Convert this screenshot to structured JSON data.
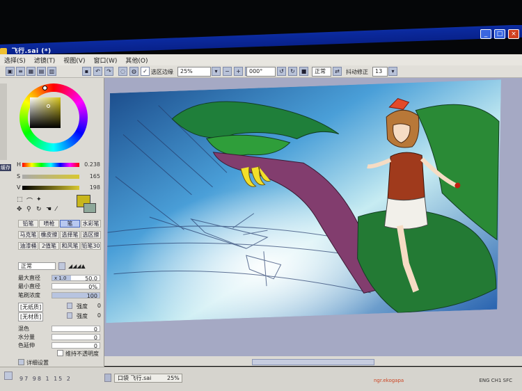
{
  "window": {
    "title": "飞行.sai (*)",
    "buttons": [
      "_",
      "□",
      "×"
    ]
  },
  "menu": [
    "选择(S)",
    "滤镜(T)",
    "视图(V)",
    "窗口(W)",
    "其他(O)"
  ],
  "toolbar": {
    "selection_edge_label": "选区边缘",
    "zoom_value": "25%",
    "angle_value": "000°",
    "blend_mode": "正常",
    "stabilizer_label": "抖动修正",
    "stabilizer_value": "13"
  },
  "color": {
    "sliders": [
      {
        "letter": "H",
        "value": "0.238"
      },
      {
        "letter": "S",
        "value": "165"
      },
      {
        "letter": "V",
        "value": "198"
      }
    ],
    "fg_hex": "#c8b61c",
    "label_tab": "缓存"
  },
  "tools": {
    "rows": [
      [
        "铅笔",
        "喷枪",
        "笔",
        "水彩笔"
      ],
      [
        "马克笔",
        "橡皮擦",
        "选择笔",
        "选区擦"
      ],
      [
        "油漆桶",
        "2值笔",
        "和风笔",
        "铅笔30"
      ]
    ],
    "active": "笔"
  },
  "brush": {
    "mode": "正常",
    "max_size_label": "最大直径",
    "max_size_mult": "x 1.0",
    "max_size_value": "50.0",
    "min_size_label": "最小直径",
    "min_size_value": "0%",
    "density_label": "笔刷浓度",
    "density_value": "100",
    "shape_label": "[无纸质]",
    "shape_strength_label": "强度",
    "shape_strength_value": "0",
    "texture_label": "[无材质]",
    "texture_strength_label": "强度",
    "texture_strength_value": "0",
    "blend_label": "混色",
    "dilution_label": "水分量",
    "persistence_label": "色延伸",
    "keep_opacity_label": "维持不透明度",
    "detail_label": "详细设置"
  },
  "statusbar": {
    "memory": "97 98 1 15 2",
    "tab_label": "口袋 飞行.sai",
    "tab_zoom": "25%",
    "watermark": "ngr.ekogapa",
    "tray": "ENG CH1 SFC"
  },
  "icons": {
    "fg_swatch": "foreground-color-swatch",
    "tools": [
      "select-rect-icon",
      "lasso-icon",
      "magic-wand-icon",
      "move-icon",
      "zoom-icon",
      "rotate-icon",
      "hand-icon",
      "eyedropper-icon"
    ]
  }
}
